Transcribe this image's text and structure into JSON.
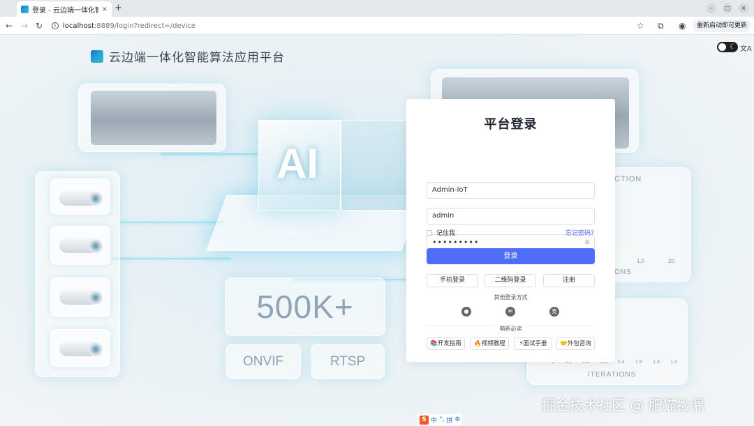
{
  "browser": {
    "tab_title": "登录 - 云边端一体化智能",
    "tab_close": "×",
    "new_tab": "+",
    "url_host": "localhost",
    "url_rest": ":8889/login?redirect=/device",
    "update_button": "重新启动即可更新",
    "window_controls": [
      "–",
      "□",
      "×"
    ]
  },
  "app": {
    "title": "云边端一体化智能算法应用平台"
  },
  "background": {
    "big_number": "500K+",
    "tags": [
      "ONVIF",
      "RTSP"
    ],
    "partial_texts": [
      "CTION",
      "ONS",
      "ITERATIONS"
    ],
    "axis_ticks_top": [
      "1.5",
      "20"
    ],
    "axis_ticks_bottom": [
      "0",
      "0.1",
      "0.4",
      "0.3",
      "0.4",
      "1.9",
      "1.3",
      "1.4"
    ],
    "cube_label": "AI"
  },
  "login": {
    "title": "平台登录",
    "tenant_value": "Admin-IoT",
    "username_value": "admin",
    "password_value": "•••••••••",
    "remember_label": "记住我",
    "forgot_label": "忘记密码?",
    "submit_label": "登录",
    "alt_methods": [
      "手机登录",
      "二维码登录",
      "注册"
    ],
    "other_methods_label": "其他登录方式",
    "social_icons": [
      "github-icon",
      "wechat-icon",
      "alipay-icon"
    ],
    "must_read_label": "萌新必读",
    "links": [
      "📚开发指南",
      "🔥视频教程",
      "⚡面试手册",
      "🤝外包咨询"
    ]
  },
  "watermark": "掘金技术社区 @ 肥猫捡漏",
  "ime": [
    "S",
    "中",
    "°,",
    "拼",
    "⚙"
  ]
}
